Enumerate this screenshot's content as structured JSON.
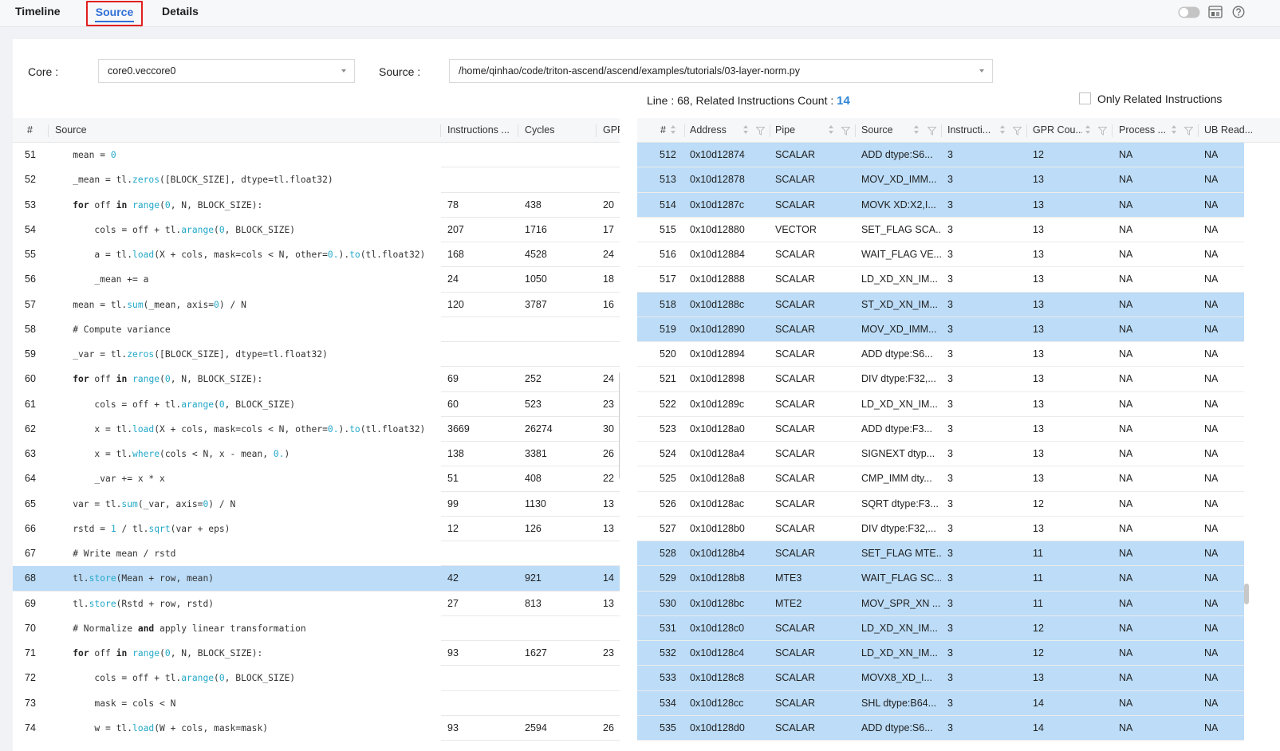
{
  "tabs": [
    {
      "label": "Timeline",
      "active": false
    },
    {
      "label": "Source",
      "active": true
    },
    {
      "label": "Details",
      "active": false
    }
  ],
  "toolbar_icons": [
    "toggle-switch-icon",
    "layout-icon",
    "help-icon"
  ],
  "accent_color": "#2f6fd6",
  "highlight_color": "#bcdcf7",
  "core": {
    "label": "Core :",
    "value": "core0.veccore0"
  },
  "source": {
    "label": "Source :",
    "value": "/home/qinhao/code/triton-ascend/ascend/examples/tutorials/03-layer-norm.py"
  },
  "info": {
    "line_text": "Line : 68, Related Instructions Count : ",
    "count": "14"
  },
  "only_related": {
    "label": "Only Related Instructions",
    "checked": false
  },
  "left_table": {
    "headers": [
      "#",
      "Source",
      "Instructions ...",
      "Cycles",
      "GPR"
    ],
    "rows": [
      {
        "line": "51",
        "code": [
          [
            "t",
            "    mean = "
          ],
          [
            "n",
            "0"
          ]
        ],
        "instr": "",
        "cycles": "",
        "gpr": "",
        "highlight": false
      },
      {
        "line": "52",
        "code": [
          [
            "t",
            "    _mean = tl."
          ],
          [
            "f",
            "zeros"
          ],
          [
            "t",
            "([BLOCK_SIZE], dtype=tl.float32)"
          ]
        ],
        "instr": "",
        "cycles": "",
        "gpr": "",
        "highlight": false
      },
      {
        "line": "53",
        "code": [
          [
            "t",
            "    "
          ],
          [
            "k",
            "for"
          ],
          [
            "t",
            " off "
          ],
          [
            "k",
            "in"
          ],
          [
            "t",
            " "
          ],
          [
            "f",
            "range"
          ],
          [
            "t",
            "("
          ],
          [
            "n",
            "0"
          ],
          [
            "t",
            ", N, BLOCK_SIZE):"
          ]
        ],
        "instr": "78",
        "cycles": "438",
        "gpr": "20",
        "highlight": false
      },
      {
        "line": "54",
        "code": [
          [
            "t",
            "        cols = off + tl."
          ],
          [
            "f",
            "arange"
          ],
          [
            "t",
            "("
          ],
          [
            "n",
            "0"
          ],
          [
            "t",
            ", BLOCK_SIZE)"
          ]
        ],
        "instr": "207",
        "cycles": "1716",
        "gpr": "17",
        "highlight": false
      },
      {
        "line": "55",
        "code": [
          [
            "t",
            "        a = tl."
          ],
          [
            "f",
            "load"
          ],
          [
            "t",
            "(X + cols, mask=cols < N, other="
          ],
          [
            "n",
            "0."
          ],
          [
            "t",
            ")."
          ],
          [
            "f",
            "to"
          ],
          [
            "t",
            "(tl.float32)"
          ]
        ],
        "instr": "168",
        "cycles": "4528",
        "gpr": "24",
        "highlight": false
      },
      {
        "line": "56",
        "code": [
          [
            "t",
            "        _mean += a"
          ]
        ],
        "instr": "24",
        "cycles": "1050",
        "gpr": "18",
        "highlight": false
      },
      {
        "line": "57",
        "code": [
          [
            "t",
            "    mean = tl."
          ],
          [
            "f",
            "sum"
          ],
          [
            "t",
            "(_mean, axis="
          ],
          [
            "n",
            "0"
          ],
          [
            "t",
            ") / N"
          ]
        ],
        "instr": "120",
        "cycles": "3787",
        "gpr": "16",
        "highlight": false
      },
      {
        "line": "58",
        "code": [
          [
            "t",
            "    # Compute variance"
          ]
        ],
        "instr": "",
        "cycles": "",
        "gpr": "",
        "highlight": false
      },
      {
        "line": "59",
        "code": [
          [
            "t",
            "    _var = tl."
          ],
          [
            "f",
            "zeros"
          ],
          [
            "t",
            "([BLOCK_SIZE], dtype=tl.float32)"
          ]
        ],
        "instr": "",
        "cycles": "",
        "gpr": "",
        "highlight": false
      },
      {
        "line": "60",
        "code": [
          [
            "t",
            "    "
          ],
          [
            "k",
            "for"
          ],
          [
            "t",
            " off "
          ],
          [
            "k",
            "in"
          ],
          [
            "t",
            " "
          ],
          [
            "f",
            "range"
          ],
          [
            "t",
            "("
          ],
          [
            "n",
            "0"
          ],
          [
            "t",
            ", N, BLOCK_SIZE):"
          ]
        ],
        "instr": "69",
        "cycles": "252",
        "gpr": "24",
        "highlight": false
      },
      {
        "line": "61",
        "code": [
          [
            "t",
            "        cols = off + tl."
          ],
          [
            "f",
            "arange"
          ],
          [
            "t",
            "("
          ],
          [
            "n",
            "0"
          ],
          [
            "t",
            ", BLOCK_SIZE)"
          ]
        ],
        "instr": "60",
        "cycles": "523",
        "gpr": "23",
        "highlight": false
      },
      {
        "line": "62",
        "code": [
          [
            "t",
            "        x = tl."
          ],
          [
            "f",
            "load"
          ],
          [
            "t",
            "(X + cols, mask=cols < N, other="
          ],
          [
            "n",
            "0."
          ],
          [
            "t",
            ")."
          ],
          [
            "f",
            "to"
          ],
          [
            "t",
            "(tl.float32)"
          ]
        ],
        "instr": "3669",
        "cycles": "26274",
        "gpr": "30",
        "highlight": false
      },
      {
        "line": "63",
        "code": [
          [
            "t",
            "        x = tl."
          ],
          [
            "f",
            "where"
          ],
          [
            "t",
            "(cols < N, x - mean, "
          ],
          [
            "n",
            "0."
          ],
          [
            "t",
            ")"
          ]
        ],
        "instr": "138",
        "cycles": "3381",
        "gpr": "26",
        "highlight": false
      },
      {
        "line": "64",
        "code": [
          [
            "t",
            "        _var += x * x"
          ]
        ],
        "instr": "51",
        "cycles": "408",
        "gpr": "22",
        "highlight": false
      },
      {
        "line": "65",
        "code": [
          [
            "t",
            "    var = tl."
          ],
          [
            "f",
            "sum"
          ],
          [
            "t",
            "(_var, axis="
          ],
          [
            "n",
            "0"
          ],
          [
            "t",
            ") / N"
          ]
        ],
        "instr": "99",
        "cycles": "1130",
        "gpr": "13",
        "highlight": false
      },
      {
        "line": "66",
        "code": [
          [
            "t",
            "    rstd = "
          ],
          [
            "n",
            "1"
          ],
          [
            "t",
            " / tl."
          ],
          [
            "f",
            "sqrt"
          ],
          [
            "t",
            "(var + eps)"
          ]
        ],
        "instr": "12",
        "cycles": "126",
        "gpr": "13",
        "highlight": false
      },
      {
        "line": "67",
        "code": [
          [
            "t",
            "    # Write mean / rstd"
          ]
        ],
        "instr": "",
        "cycles": "",
        "gpr": "",
        "highlight": false
      },
      {
        "line": "68",
        "code": [
          [
            "t",
            "    tl."
          ],
          [
            "f",
            "store"
          ],
          [
            "t",
            "(Mean + row, mean)"
          ]
        ],
        "instr": "42",
        "cycles": "921",
        "gpr": "14",
        "highlight": true
      },
      {
        "line": "69",
        "code": [
          [
            "t",
            "    tl."
          ],
          [
            "f",
            "store"
          ],
          [
            "t",
            "(Rstd + row, rstd)"
          ]
        ],
        "instr": "27",
        "cycles": "813",
        "gpr": "13",
        "highlight": false
      },
      {
        "line": "70",
        "code": [
          [
            "t",
            "    # Normalize "
          ],
          [
            "k",
            "and"
          ],
          [
            "t",
            " apply linear transformation"
          ]
        ],
        "instr": "",
        "cycles": "",
        "gpr": "",
        "highlight": false
      },
      {
        "line": "71",
        "code": [
          [
            "t",
            "    "
          ],
          [
            "k",
            "for"
          ],
          [
            "t",
            " off "
          ],
          [
            "k",
            "in"
          ],
          [
            "t",
            " "
          ],
          [
            "f",
            "range"
          ],
          [
            "t",
            "("
          ],
          [
            "n",
            "0"
          ],
          [
            "t",
            ", N, BLOCK_SIZE):"
          ]
        ],
        "instr": "93",
        "cycles": "1627",
        "gpr": "23",
        "highlight": false
      },
      {
        "line": "72",
        "code": [
          [
            "t",
            "        cols = off + tl."
          ],
          [
            "f",
            "arange"
          ],
          [
            "t",
            "("
          ],
          [
            "n",
            "0"
          ],
          [
            "t",
            ", BLOCK_SIZE)"
          ]
        ],
        "instr": "",
        "cycles": "",
        "gpr": "",
        "highlight": false
      },
      {
        "line": "73",
        "code": [
          [
            "t",
            "        mask = cols < N"
          ]
        ],
        "instr": "",
        "cycles": "",
        "gpr": "",
        "highlight": false
      },
      {
        "line": "74",
        "code": [
          [
            "t",
            "        w = tl."
          ],
          [
            "f",
            "load"
          ],
          [
            "t",
            "(W + cols, mask=mask)"
          ]
        ],
        "instr": "93",
        "cycles": "2594",
        "gpr": "26",
        "highlight": false
      }
    ]
  },
  "right_table": {
    "headers": [
      "#",
      "Address",
      "Pipe",
      "Source",
      "Instructi...",
      "GPR Cou...",
      "Process ...",
      "UB Read..."
    ],
    "rows": [
      {
        "n": "512",
        "addr": "0x10d12874",
        "pipe": "SCALAR",
        "src": "ADD dtype:S6...",
        "instr": "3",
        "gpr": "12",
        "proc": "NA",
        "ub": "NA",
        "highlight": true
      },
      {
        "n": "513",
        "addr": "0x10d12878",
        "pipe": "SCALAR",
        "src": "MOV_XD_IMM...",
        "instr": "3",
        "gpr": "13",
        "proc": "NA",
        "ub": "NA",
        "highlight": true
      },
      {
        "n": "514",
        "addr": "0x10d1287c",
        "pipe": "SCALAR",
        "src": "MOVK XD:X2,I...",
        "instr": "3",
        "gpr": "13",
        "proc": "NA",
        "ub": "NA",
        "highlight": true
      },
      {
        "n": "515",
        "addr": "0x10d12880",
        "pipe": "VECTOR",
        "src": "SET_FLAG SCA...",
        "instr": "3",
        "gpr": "13",
        "proc": "NA",
        "ub": "NA",
        "highlight": false
      },
      {
        "n": "516",
        "addr": "0x10d12884",
        "pipe": "SCALAR",
        "src": "WAIT_FLAG VE...",
        "instr": "3",
        "gpr": "13",
        "proc": "NA",
        "ub": "NA",
        "highlight": false
      },
      {
        "n": "517",
        "addr": "0x10d12888",
        "pipe": "SCALAR",
        "src": "LD_XD_XN_IM...",
        "instr": "3",
        "gpr": "13",
        "proc": "NA",
        "ub": "NA",
        "highlight": false
      },
      {
        "n": "518",
        "addr": "0x10d1288c",
        "pipe": "SCALAR",
        "src": "ST_XD_XN_IM...",
        "instr": "3",
        "gpr": "13",
        "proc": "NA",
        "ub": "NA",
        "highlight": true
      },
      {
        "n": "519",
        "addr": "0x10d12890",
        "pipe": "SCALAR",
        "src": "MOV_XD_IMM...",
        "instr": "3",
        "gpr": "13",
        "proc": "NA",
        "ub": "NA",
        "highlight": true
      },
      {
        "n": "520",
        "addr": "0x10d12894",
        "pipe": "SCALAR",
        "src": "ADD dtype:S6...",
        "instr": "3",
        "gpr": "13",
        "proc": "NA",
        "ub": "NA",
        "highlight": false
      },
      {
        "n": "521",
        "addr": "0x10d12898",
        "pipe": "SCALAR",
        "src": "DIV dtype:F32,...",
        "instr": "3",
        "gpr": "13",
        "proc": "NA",
        "ub": "NA",
        "highlight": false
      },
      {
        "n": "522",
        "addr": "0x10d1289c",
        "pipe": "SCALAR",
        "src": "LD_XD_XN_IM...",
        "instr": "3",
        "gpr": "13",
        "proc": "NA",
        "ub": "NA",
        "highlight": false
      },
      {
        "n": "523",
        "addr": "0x10d128a0",
        "pipe": "SCALAR",
        "src": "ADD dtype:F3...",
        "instr": "3",
        "gpr": "13",
        "proc": "NA",
        "ub": "NA",
        "highlight": false
      },
      {
        "n": "524",
        "addr": "0x10d128a4",
        "pipe": "SCALAR",
        "src": "SIGNEXT dtyp...",
        "instr": "3",
        "gpr": "13",
        "proc": "NA",
        "ub": "NA",
        "highlight": false
      },
      {
        "n": "525",
        "addr": "0x10d128a8",
        "pipe": "SCALAR",
        "src": "CMP_IMM dty...",
        "instr": "3",
        "gpr": "13",
        "proc": "NA",
        "ub": "NA",
        "highlight": false
      },
      {
        "n": "526",
        "addr": "0x10d128ac",
        "pipe": "SCALAR",
        "src": "SQRT dtype:F3...",
        "instr": "3",
        "gpr": "12",
        "proc": "NA",
        "ub": "NA",
        "highlight": false
      },
      {
        "n": "527",
        "addr": "0x10d128b0",
        "pipe": "SCALAR",
        "src": "DIV dtype:F32,...",
        "instr": "3",
        "gpr": "13",
        "proc": "NA",
        "ub": "NA",
        "highlight": false
      },
      {
        "n": "528",
        "addr": "0x10d128b4",
        "pipe": "SCALAR",
        "src": "SET_FLAG MTE...",
        "instr": "3",
        "gpr": "11",
        "proc": "NA",
        "ub": "NA",
        "highlight": true
      },
      {
        "n": "529",
        "addr": "0x10d128b8",
        "pipe": "MTE3",
        "src": "WAIT_FLAG SC...",
        "instr": "3",
        "gpr": "11",
        "proc": "NA",
        "ub": "NA",
        "highlight": true
      },
      {
        "n": "530",
        "addr": "0x10d128bc",
        "pipe": "MTE2",
        "src": "MOV_SPR_XN ...",
        "instr": "3",
        "gpr": "11",
        "proc": "NA",
        "ub": "NA",
        "highlight": true
      },
      {
        "n": "531",
        "addr": "0x10d128c0",
        "pipe": "SCALAR",
        "src": "LD_XD_XN_IM...",
        "instr": "3",
        "gpr": "12",
        "proc": "NA",
        "ub": "NA",
        "highlight": true
      },
      {
        "n": "532",
        "addr": "0x10d128c4",
        "pipe": "SCALAR",
        "src": "LD_XD_XN_IM...",
        "instr": "3",
        "gpr": "12",
        "proc": "NA",
        "ub": "NA",
        "highlight": true
      },
      {
        "n": "533",
        "addr": "0x10d128c8",
        "pipe": "SCALAR",
        "src": "MOVX8_XD_I...",
        "instr": "3",
        "gpr": "13",
        "proc": "NA",
        "ub": "NA",
        "highlight": true
      },
      {
        "n": "534",
        "addr": "0x10d128cc",
        "pipe": "SCALAR",
        "src": "SHL dtype:B64...",
        "instr": "3",
        "gpr": "14",
        "proc": "NA",
        "ub": "NA",
        "highlight": true
      },
      {
        "n": "535",
        "addr": "0x10d128d0",
        "pipe": "SCALAR",
        "src": "ADD dtype:S6...",
        "instr": "3",
        "gpr": "14",
        "proc": "NA",
        "ub": "NA",
        "highlight": true
      }
    ]
  }
}
